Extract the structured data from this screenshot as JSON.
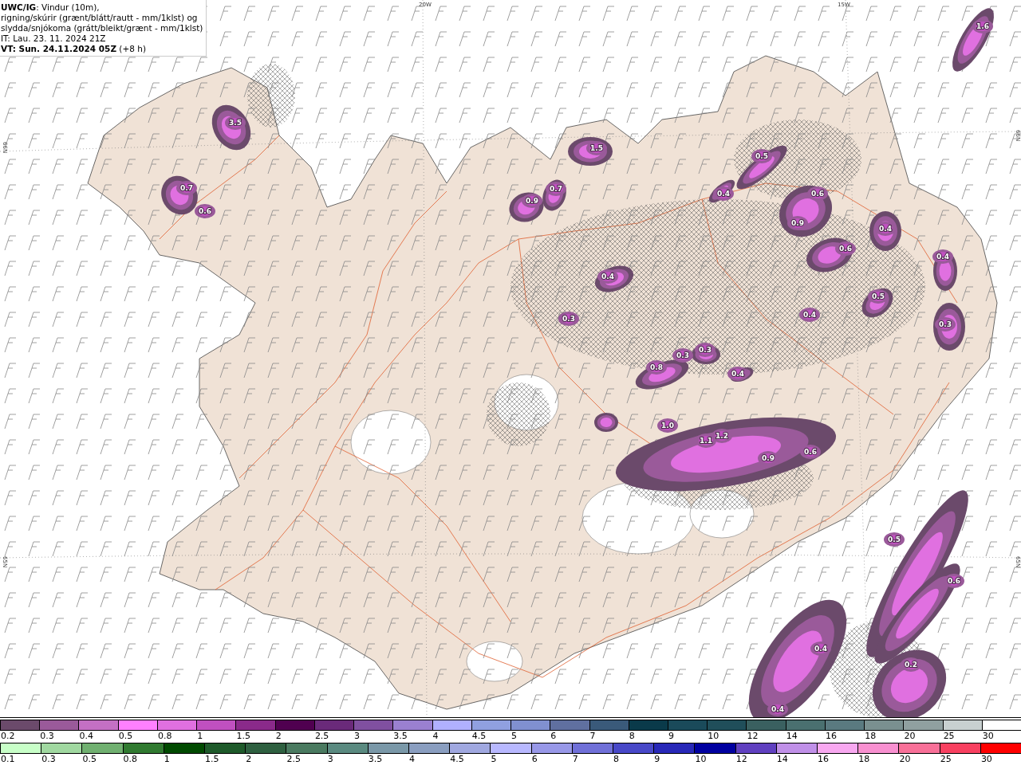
{
  "header": {
    "lines": [
      "**UWC/IG**: Vindur (10m),",
      "rigning/skúrir (grænt/blátt/rautt - mm/1klst) og",
      "slydda/snjókoma (grátt/bleikt/grænt - mm/1klst)",
      "IT: Lau. 23. 11. 2024 21Z",
      "**VT: Sun. 24.11.2024 05Z** (+8 h)"
    ]
  },
  "map": {
    "grid_labels": [
      "20W",
      "15W",
      "66N",
      "66N",
      "65N",
      "65N"
    ],
    "precip_labels": [
      "3.5",
      "0.7",
      "0.6",
      "1.5",
      "0.9",
      "0.7",
      "0.5",
      "0.4",
      "0.6",
      "0.9",
      "0.6",
      "0.4",
      "0.4",
      "0.5",
      "0.3",
      "0.4",
      "0.8",
      "0.3",
      "0.3",
      "0.4",
      "0.3",
      "0.4",
      "1.0",
      "1.1",
      "1.2",
      "0.9",
      "0.6",
      "0.4",
      "0.5",
      "0.6",
      "0.2",
      "0.4",
      "1.6"
    ]
  },
  "legend_snow": [
    {
      "label": "0.2",
      "color": "#6b4a6b"
    },
    {
      "label": "0.3",
      "color": "#9a5a9a"
    },
    {
      "label": "0.4",
      "color": "#c470c4"
    },
    {
      "label": "0.5",
      "color": "#ff80ff"
    },
    {
      "label": "0.8",
      "color": "#e070e0"
    },
    {
      "label": "1",
      "color": "#c050c0"
    },
    {
      "label": "1.5",
      "color": "#8a2a8a"
    },
    {
      "label": "2",
      "color": "#500050"
    },
    {
      "label": "2.5",
      "color": "#6a2a7a"
    },
    {
      "label": "3",
      "color": "#8050a0"
    },
    {
      "label": "3.5",
      "color": "#9a80d0"
    },
    {
      "label": "4",
      "color": "#b0b0ff"
    },
    {
      "label": "4.5",
      "color": "#90a0e0"
    },
    {
      "label": "5",
      "color": "#8090d0"
    },
    {
      "label": "6",
      "color": "#6070a0"
    },
    {
      "label": "7",
      "color": "#3a5a7a"
    },
    {
      "label": "8",
      "color": "#0a3a4a"
    },
    {
      "label": "9",
      "color": "#1a4a5a"
    },
    {
      "label": "10",
      "color": "#204e5a"
    },
    {
      "label": "12",
      "color": "#3a6060"
    },
    {
      "label": "14",
      "color": "#4a7070"
    },
    {
      "label": "16",
      "color": "#5a7a80"
    },
    {
      "label": "18",
      "color": "#7a9090"
    },
    {
      "label": "20",
      "color": "#90a0a0"
    },
    {
      "label": "25",
      "color": "#c8d0d0"
    },
    {
      "label": "30",
      "color": "#ffffff"
    }
  ],
  "legend_rain": [
    {
      "label": "0.1",
      "color": "#c8ffc8"
    },
    {
      "label": "0.3",
      "color": "#a0d8a0"
    },
    {
      "label": "0.5",
      "color": "#70b070"
    },
    {
      "label": "0.8",
      "color": "#307a30"
    },
    {
      "label": "1",
      "color": "#004a00"
    },
    {
      "label": "1.5",
      "color": "#1e5a2a"
    },
    {
      "label": "2",
      "color": "#2e6040"
    },
    {
      "label": "2.5",
      "color": "#4a7a60"
    },
    {
      "label": "3",
      "color": "#5a8a80"
    },
    {
      "label": "3.5",
      "color": "#7a98a8"
    },
    {
      "label": "4",
      "color": "#8a9ec0"
    },
    {
      "label": "4.5",
      "color": "#a0a8e0"
    },
    {
      "label": "5",
      "color": "#b8b8ff"
    },
    {
      "label": "6",
      "color": "#9898e8"
    },
    {
      "label": "7",
      "color": "#7070d8"
    },
    {
      "label": "8",
      "color": "#4848c8"
    },
    {
      "label": "9",
      "color": "#2828b8"
    },
    {
      "label": "10",
      "color": "#0000a0"
    },
    {
      "label": "12",
      "color": "#6040c0"
    },
    {
      "label": "14",
      "color": "#c090e8"
    },
    {
      "label": "16",
      "color": "#f8a8f0"
    },
    {
      "label": "18",
      "color": "#f890d0"
    },
    {
      "label": "20",
      "color": "#f87098"
    },
    {
      "label": "25",
      "color": "#f84060"
    },
    {
      "label": "30",
      "color": "#ff0000"
    }
  ]
}
